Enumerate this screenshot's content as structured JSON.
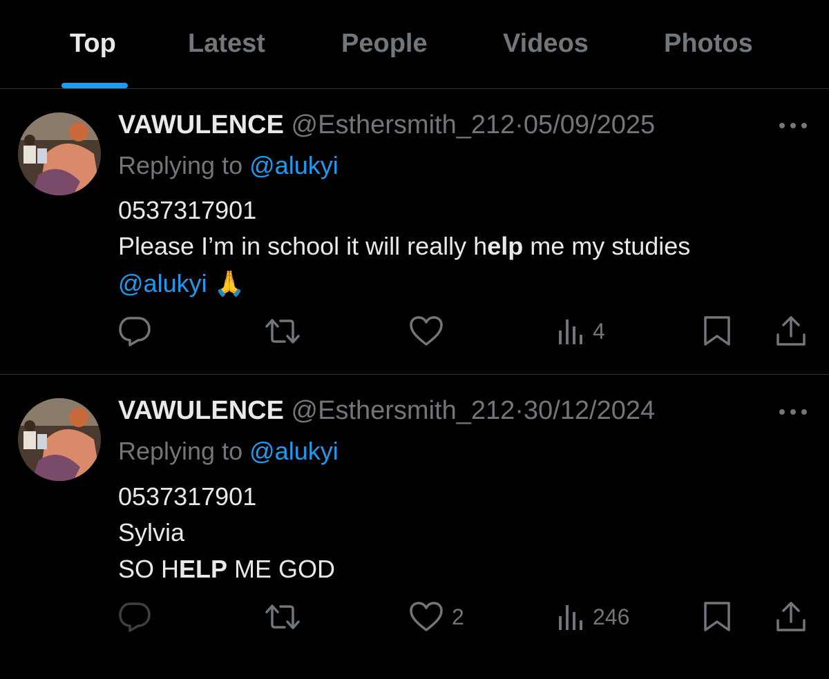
{
  "tabs": [
    {
      "label": "Top",
      "active": true
    },
    {
      "label": "Latest",
      "active": false
    },
    {
      "label": "People",
      "active": false
    },
    {
      "label": "Videos",
      "active": false
    },
    {
      "label": "Photos",
      "active": false
    }
  ],
  "colors": {
    "background": "#000000",
    "text": "#e7e9ea",
    "muted": "#71767b",
    "accent": "#1d9bf0",
    "divider": "#2f3336"
  },
  "tweets": [
    {
      "display_name": "VAWULENCE",
      "handle": "@Esthersmith_212",
      "separator": "·",
      "date": "05/09/2025",
      "replying_prefix": "Replying to",
      "replying_to": "@alukyi",
      "line1": "0537317901",
      "line2_a": "Please I’m in school it will really h",
      "line2_b": "elp",
      "line2_c": " me my studies",
      "line3_mention": "@alukyi",
      "line3_emoji": "🙏",
      "actions": {
        "reply_icon": "reply-icon",
        "retweet_icon": "retweet-icon",
        "like_icon": "heart-icon",
        "like_count": "",
        "views_icon": "views-icon",
        "views_count": "4",
        "bookmark_icon": "bookmark-icon",
        "share_icon": "share-icon"
      }
    },
    {
      "display_name": "VAWULENCE",
      "handle": "@Esthersmith_212",
      "separator": "·",
      "date": "30/12/2024",
      "replying_prefix": "Replying to",
      "replying_to": "@alukyi",
      "line1": "0537317901",
      "line2": "Sylvia",
      "line3_a": "SO H",
      "line3_b": "ELP",
      "line3_c": " ME GOD",
      "actions": {
        "reply_icon": "reply-icon",
        "retweet_icon": "retweet-icon",
        "like_icon": "heart-icon",
        "like_count": "2",
        "views_icon": "views-icon",
        "views_count": "246",
        "bookmark_icon": "bookmark-icon",
        "share_icon": "share-icon"
      }
    }
  ]
}
